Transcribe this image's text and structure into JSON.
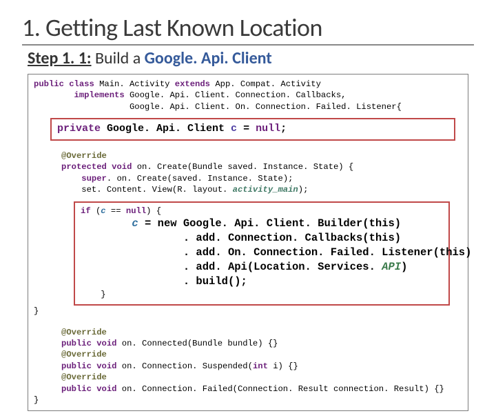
{
  "title": "1. Getting Last Known Location",
  "subtitle": {
    "step": "Step 1. 1:",
    "build": "Build a",
    "apiclient": "Google. Api. Client"
  },
  "code": {
    "sig_public": "public class",
    "sig_class": " Main. Activity ",
    "sig_extends": "extends",
    "sig_super": " App. Compat. Activity",
    "sig_impl_kw": "implements",
    "sig_impl1": " Google. Api. Client. Connection. Callbacks,",
    "sig_impl2": "Google. Api. Client. On. Connection. Failed. Listener{",
    "decl_private": "private",
    "decl_type": " Google. Api. Client ",
    "decl_var": "c",
    "decl_eq": " = ",
    "decl_null": "null",
    "decl_semi": ";",
    "ov1_ann": "@Override",
    "ov1_mod": "protected void",
    "ov1_sig": " on. Create(Bundle saved. Instance. State) {",
    "ov1_super_kw": "super",
    "ov1_super_rest": ". on. Create(saved. Instance. State);",
    "ov1_setcv_a": "    set. Content. View(R. layout. ",
    "ov1_setcv_b": "activity_main",
    "ov1_setcv_c": ");",
    "if_kw": "if",
    "if_cond_a": " (",
    "if_cond_var": "c",
    "if_cond_b": " == ",
    "if_cond_null": "null",
    "if_cond_c": ") {",
    "bld_line1_var": "c",
    "bld_line1_rest": " = new Google. Api. Client. Builder(this)",
    "bld_line2": ". add. Connection. Callbacks(this)",
    "bld_line3": ". add. On. Connection. Failed. Listener(this)",
    "bld_line4a": ". add. Api(Location. Services. ",
    "bld_line4b": "API",
    "bld_line4c": ")",
    "bld_line5": ". build();",
    "if_close": "}",
    "on_create_close": "}",
    "ov2_ann": "@Override",
    "ov2_mod": "public void",
    "ov2_sig": " on. Connected(Bundle bundle) {}",
    "ov3_ann": "@Override",
    "ov3_mod": "public void",
    "ov3_sig_a": " on. Connection. Suspended(",
    "ov3_int": "int",
    "ov3_sig_b": " i) {}",
    "ov4_ann": "@Override",
    "ov4_mod": "public void",
    "ov4_sig": " on. Connection. Failed(Connection. Result connection. Result) {}",
    "class_close": "}"
  }
}
